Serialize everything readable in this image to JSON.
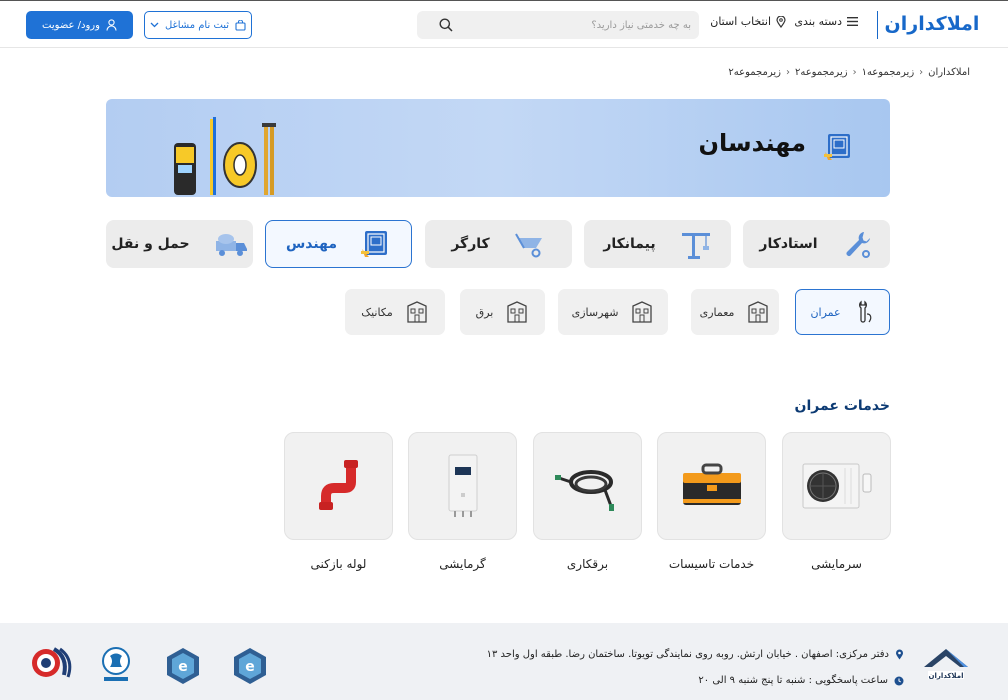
{
  "header": {
    "logo": "املاکداران",
    "category_label": "دسته بندی",
    "province_label": "انتخاب استان",
    "search_placeholder": "به چه خدمتی نیاز دارید؟",
    "job_button": "ثبت نام مشاغل",
    "login_button": "ورود/ عضویت"
  },
  "breadcrumb": [
    "املاکداران",
    "زیرمجموعه۱",
    "زیرمجموعه۲",
    "زیرمجموعه۲"
  ],
  "banner": {
    "title": "مهندسان"
  },
  "main_categories": [
    {
      "label": "استادکار",
      "icon": "wrench-icon",
      "active": false
    },
    {
      "label": "پیمانکار",
      "icon": "crane-icon",
      "active": false
    },
    {
      "label": "کارگر",
      "icon": "wheelbarrow-icon",
      "active": false
    },
    {
      "label": "مهندس",
      "icon": "blueprint-icon",
      "active": true
    },
    {
      "label": "حمل و نقل",
      "icon": "truck-icon",
      "active": false
    }
  ],
  "sub_categories": [
    {
      "label": "عمران",
      "icon": "wrench-hand-icon",
      "active": true
    },
    {
      "label": "معماری",
      "icon": "building-icon",
      "active": false
    },
    {
      "label": "شهرسازی",
      "icon": "building-icon",
      "active": false
    },
    {
      "label": "برق",
      "icon": "building-icon",
      "active": false
    },
    {
      "label": "مکانیک",
      "icon": "building-icon",
      "active": false
    }
  ],
  "section": {
    "title": "خدمات عمران"
  },
  "services": [
    {
      "label": "سرمایشی",
      "icon": "air-conditioner-icon"
    },
    {
      "label": "خدمات تاسیسات",
      "icon": "toolbox-icon"
    },
    {
      "label": "برقکاری",
      "icon": "cable-icon"
    },
    {
      "label": "گرمایشی",
      "icon": "water-heater-icon"
    },
    {
      "label": "لوله بازکنی",
      "icon": "pipe-icon"
    }
  ],
  "footer": {
    "address": "دفتر مرکزی: اصفهان . خیابان ارتش. روبه روی نمایندگی تویوتا. ساختمان رضا. طبقه اول واحد ۱۳",
    "hours": "ساعت پاسخگویی : شنبه تا پنج شنبه ۹ الی ۲۰",
    "logo": "املاکداران"
  },
  "colors": {
    "primary": "#1f72d6",
    "nav_dark": "#0c3a73",
    "banner": "#b8d0f3"
  }
}
